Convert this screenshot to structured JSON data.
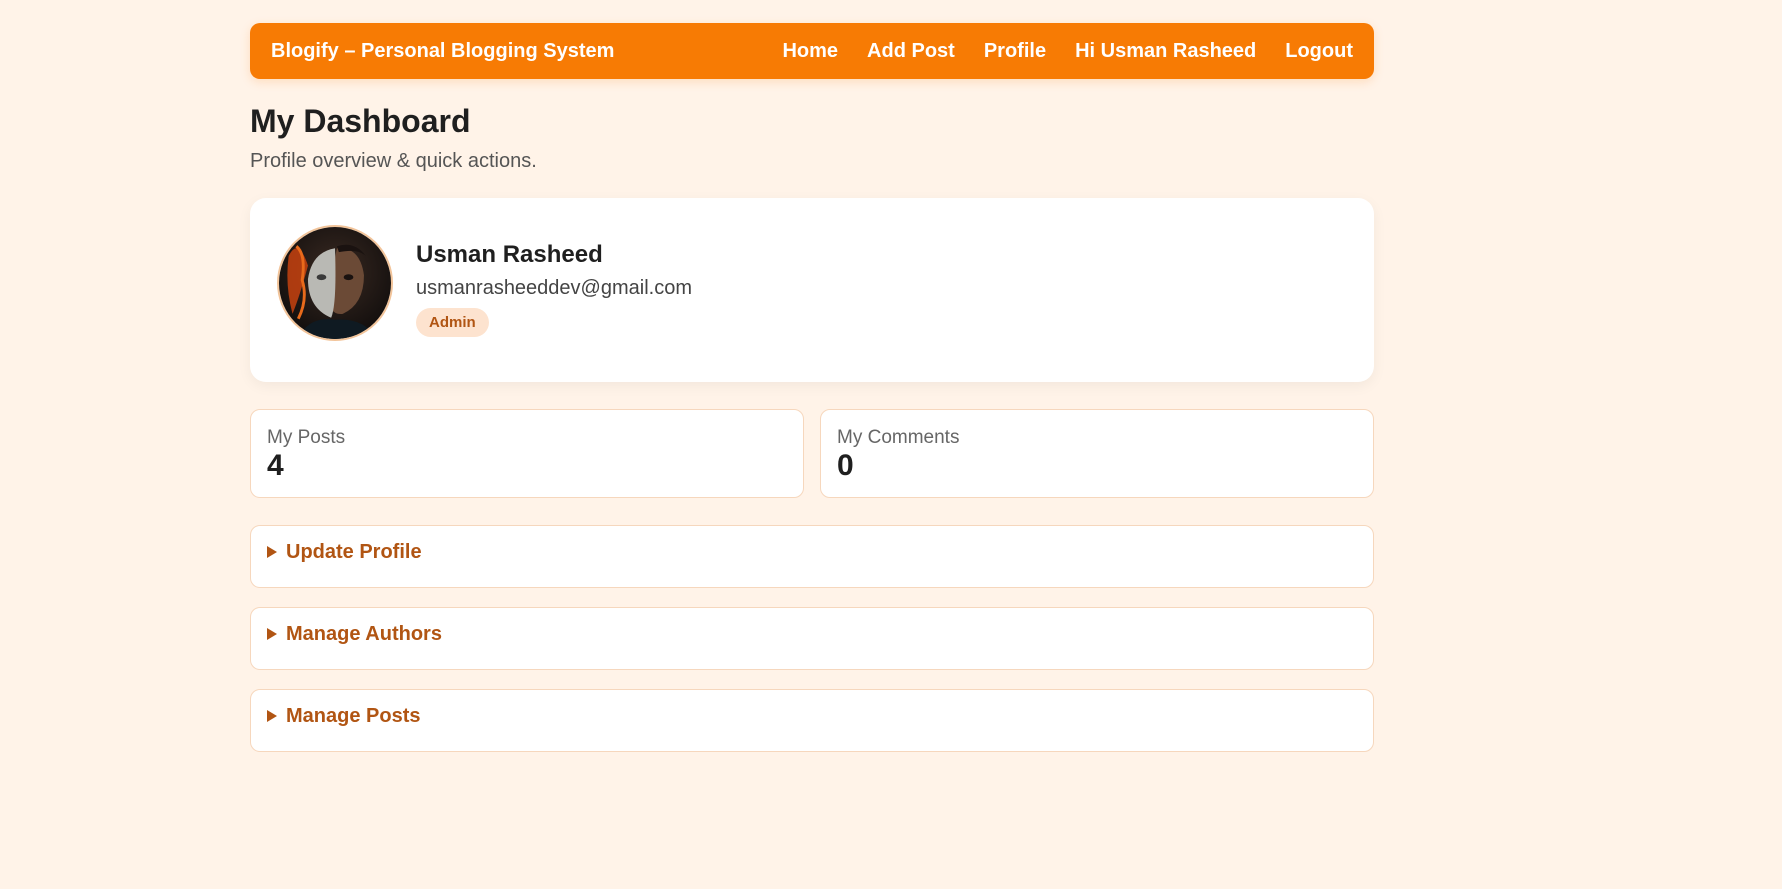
{
  "navbar": {
    "brand": "Blogify – Personal Blogging System",
    "links": [
      "Home",
      "Add Post",
      "Profile",
      "Hi Usman Rasheed",
      "Logout"
    ]
  },
  "page": {
    "title": "My Dashboard",
    "subtitle": "Profile overview & quick actions."
  },
  "profile": {
    "name": "Usman Rasheed",
    "email": "usmanrasheeddev@gmail.com",
    "role": "Admin",
    "avatar_icon": "user-avatar"
  },
  "stats": [
    {
      "label": "My Posts",
      "value": "4"
    },
    {
      "label": "My Comments",
      "value": "0"
    }
  ],
  "sections": [
    {
      "label": "Update Profile"
    },
    {
      "label": "Manage Authors"
    },
    {
      "label": "Manage Posts"
    }
  ],
  "colors": {
    "accent": "#f77b04",
    "background": "#fff3e8",
    "section_text": "#b15513",
    "badge_bg": "#fde3cf"
  }
}
